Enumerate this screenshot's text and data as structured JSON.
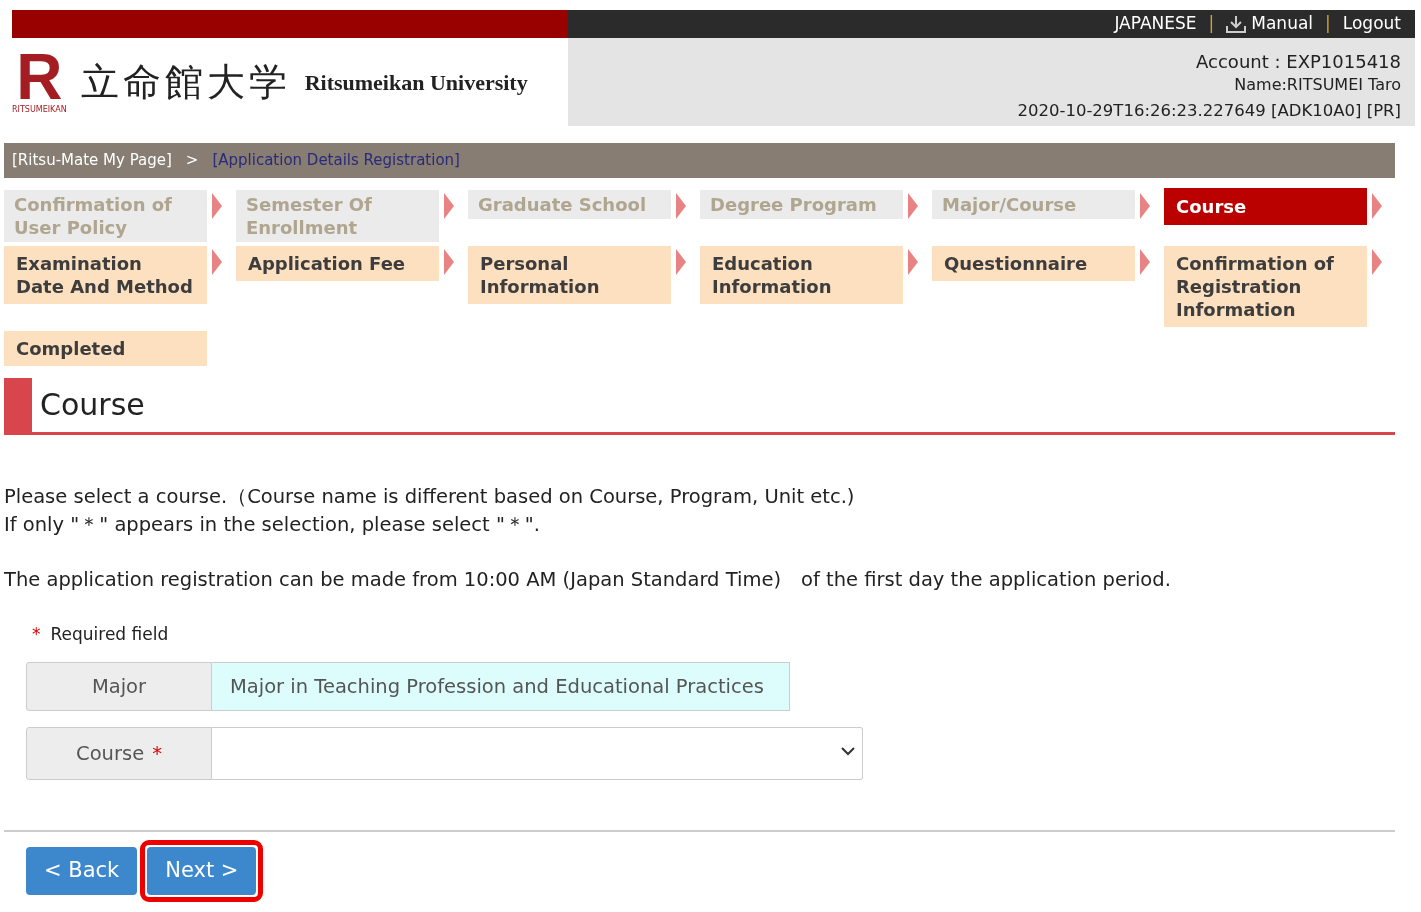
{
  "header": {
    "link_separator": "|",
    "top_links": [
      {
        "label": "JAPANESE",
        "kind": "plain"
      },
      {
        "label": "Manual",
        "kind": "download"
      },
      {
        "label": "Logout",
        "kind": "plain"
      }
    ],
    "logo": {
      "mark": "R",
      "mark_caption": "RITSUMEIKAN",
      "name_ja": "立命館大学",
      "name_en": "Ritsumeikan University"
    },
    "account": "Account : EXP1015418",
    "name": "Name:RITSUMEI Taro",
    "session": "2020-10-29T16:26:23.227649 [ADK10A0] [PR]"
  },
  "breadcrumb": {
    "separator": ">",
    "items": [
      {
        "label": "[Ritsu-Mate My Page]",
        "selected": false
      },
      {
        "label": "[Application Details Registration]",
        "selected": true
      }
    ]
  },
  "steps": [
    {
      "label": "Confirmation of User Policy",
      "completed": true,
      "selected": false
    },
    {
      "label": "Semester Of Enrollment",
      "completed": true,
      "selected": false
    },
    {
      "label": "Graduate School",
      "completed": true,
      "selected": false
    },
    {
      "label": "Degree Program",
      "completed": true,
      "selected": false
    },
    {
      "label": "Major/Course",
      "completed": true,
      "selected": false
    },
    {
      "label": "Course",
      "completed": false,
      "selected": true
    },
    {
      "label": "Examination Date And Method",
      "completed": false,
      "selected": false
    },
    {
      "label": "Application Fee",
      "completed": false,
      "selected": false
    },
    {
      "label": "Personal Information",
      "completed": false,
      "selected": false
    },
    {
      "label": "Education Information",
      "completed": false,
      "selected": false
    },
    {
      "label": "Questionnaire",
      "completed": false,
      "selected": false
    },
    {
      "label": "Confirmation of Registration Information",
      "completed": false,
      "selected": false
    },
    {
      "label": "Completed",
      "completed": false,
      "selected": false
    }
  ],
  "heading": "Course",
  "notes": [
    "Please select a course.（Course name is different based on Course, Program, Unit etc.)",
    "If only \"＊\" appears in the selection, please select \"＊\".",
    "The application registration can be made from 10:00 AM (Japan Standard Time)　of the first day the application period."
  ],
  "form": {
    "required_mark": "*",
    "required_note": "Required field",
    "rows": [
      {
        "label": "Major",
        "kind": "display",
        "required": false,
        "value": "Major in Teaching Profession and Educational Practices"
      },
      {
        "label": "Course",
        "kind": "select",
        "required": true
      }
    ]
  },
  "buttons": [
    {
      "label": "< Back",
      "highlighted": false
    },
    {
      "label": "Next >",
      "highlighted": true
    }
  ]
}
